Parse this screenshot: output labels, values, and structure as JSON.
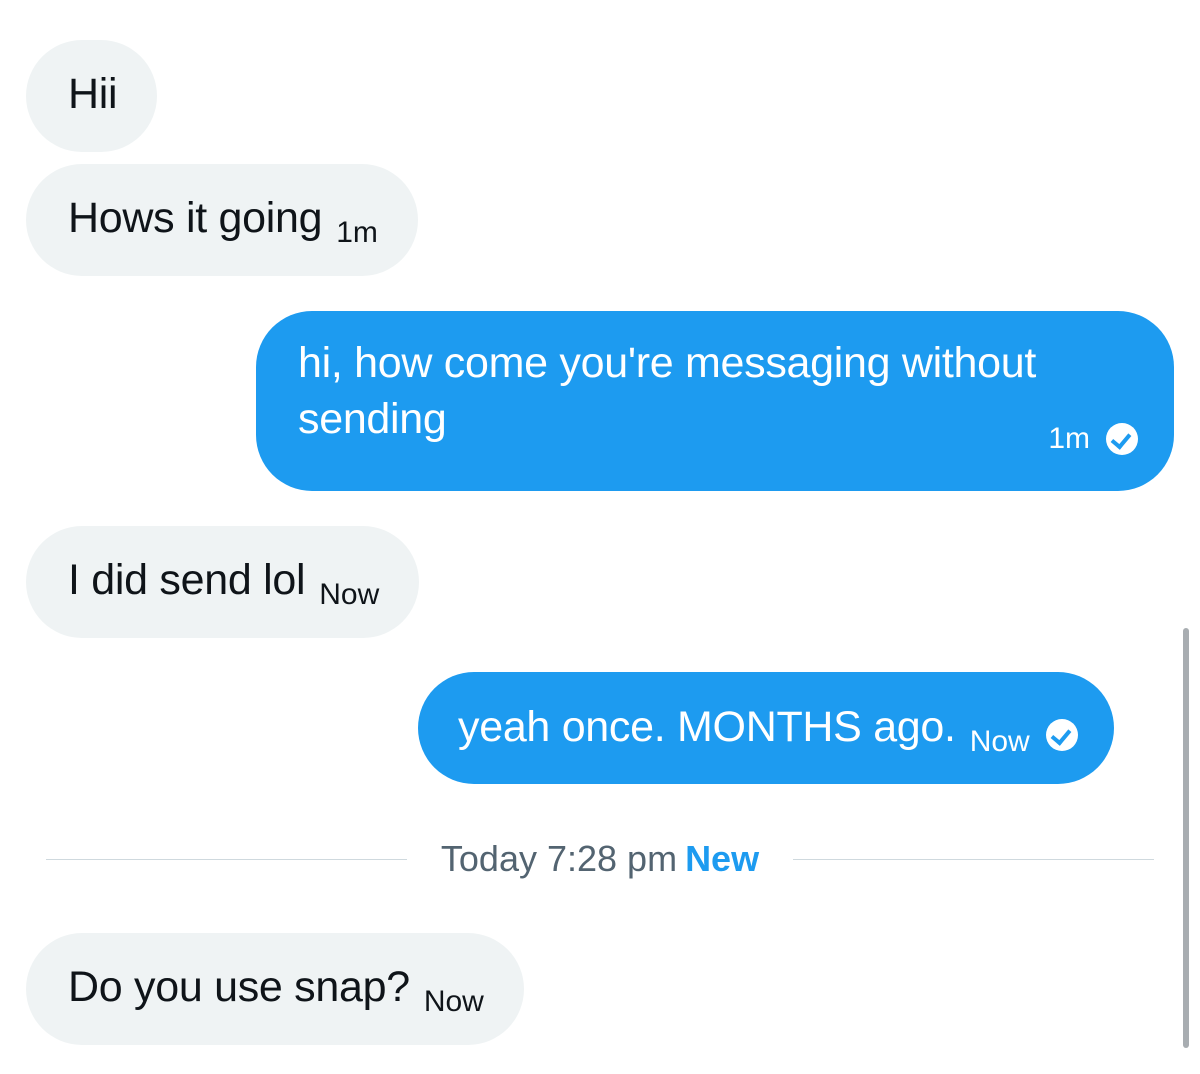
{
  "messages": [
    {
      "id": "m1",
      "direction": "incoming",
      "text": "Hii",
      "time": ""
    },
    {
      "id": "m2",
      "direction": "incoming",
      "text": "Hows it going",
      "time": "1m"
    },
    {
      "id": "m3",
      "direction": "outgoing",
      "text": "hi, how come you're messaging without sending",
      "time": "1m",
      "status": "seen-check-icon"
    },
    {
      "id": "m4",
      "direction": "incoming",
      "text": "I did send lol",
      "time": "Now"
    },
    {
      "id": "m5",
      "direction": "outgoing",
      "text": "yeah once. MONTHS ago.",
      "time": "Now",
      "status": "seen-check-icon"
    },
    {
      "id": "m6",
      "direction": "incoming",
      "text": "Do you use snap?",
      "time": "Now"
    }
  ],
  "divider": {
    "timestamp": "Today 7:28 pm",
    "new_label": "New"
  },
  "colors": {
    "incoming_bubble": "#eff3f4",
    "outgoing_bubble": "#1d9bf0",
    "accent": "#1d9bf0",
    "muted_text": "#536471"
  }
}
